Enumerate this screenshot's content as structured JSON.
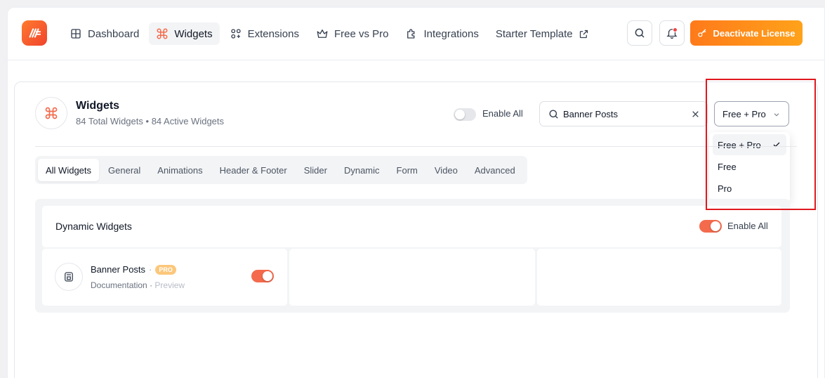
{
  "nav": {
    "items": [
      {
        "label": "Dashboard",
        "icon": "dashboard-grid-icon"
      },
      {
        "label": "Widgets",
        "icon": "command-icon",
        "active": true
      },
      {
        "label": "Extensions",
        "icon": "extensions-icon"
      },
      {
        "label": "Free vs Pro",
        "icon": "crown-icon"
      },
      {
        "label": "Integrations",
        "icon": "puzzle-icon"
      },
      {
        "label": "Starter Template",
        "icon": "external-link-icon"
      }
    ],
    "license_button": "Deactivate License"
  },
  "widgets": {
    "title": "Widgets",
    "total_text": "84 Total Widgets",
    "active_text": "84 Active Widgets",
    "separator": "•",
    "enable_all_label": "Enable All",
    "enable_all_on": false,
    "search": {
      "value": "Banner Posts",
      "placeholder": "Search"
    },
    "filter": {
      "selected": "Free + Pro",
      "options": [
        {
          "label": "Free + Pro",
          "selected": true
        },
        {
          "label": "Free",
          "selected": false
        },
        {
          "label": "Pro",
          "selected": false
        }
      ]
    },
    "tabs": [
      "All Widgets",
      "General",
      "Animations",
      "Header & Footer",
      "Slider",
      "Dynamic",
      "Form",
      "Video",
      "Advanced"
    ],
    "active_tab": "All Widgets"
  },
  "section": {
    "title": "Dynamic Widgets",
    "enable_all_label": "Enable All",
    "enable_all_on": true,
    "items": [
      {
        "name": "Banner Posts",
        "badge": "PRO",
        "doc_label": "Documentation",
        "preview_label": "Preview",
        "enabled": true
      }
    ]
  },
  "colors": {
    "accent": "#f46a4c",
    "license_gradient_start": "#ff7a1a",
    "license_gradient_end": "#ffa21a",
    "pro_badge": "#fcc77b",
    "highlight_box": "#e0181e"
  }
}
